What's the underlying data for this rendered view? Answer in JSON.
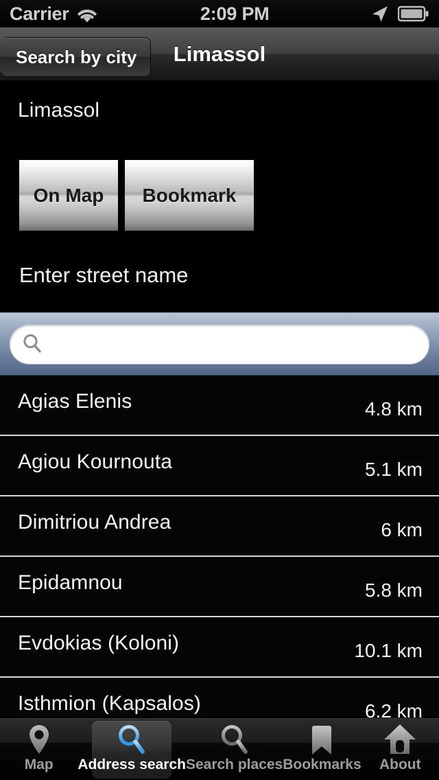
{
  "status_bar": {
    "carrier": "Carrier",
    "time": "2:09 PM",
    "wifi_icon": "wifi-icon",
    "location_icon": "location-arrow-icon",
    "battery_icon": "battery-icon"
  },
  "nav_bar": {
    "back_label": "Search by city",
    "title": "Limassol"
  },
  "main": {
    "city_name": "Limassol",
    "on_map_label": "On Map",
    "bookmark_label": "Bookmark",
    "street_prompt": "Enter street name"
  },
  "search": {
    "value": "",
    "placeholder": "",
    "icon": "search-icon"
  },
  "results": [
    {
      "name": "Agias Elenis",
      "distance": "4.8 km"
    },
    {
      "name": "Agiou Kournouta",
      "distance": "5.1 km"
    },
    {
      "name": "Dimitriou Andrea",
      "distance": "6 km"
    },
    {
      "name": "Epidamnou",
      "distance": "5.8 km"
    },
    {
      "name": "Evdokias (Koloni)",
      "distance": "10.1 km"
    },
    {
      "name": "Isthmion (Kapsalos)",
      "distance": "6.2 km"
    }
  ],
  "tabs": [
    {
      "label": "Map",
      "icon": "map-pin-icon",
      "selected": false
    },
    {
      "label": "Address search",
      "icon": "magnifier-blue-icon",
      "selected": true
    },
    {
      "label": "Search places",
      "icon": "magnifier-gray-icon",
      "selected": false
    },
    {
      "label": "Bookmarks",
      "icon": "bookmark-ribbon-icon",
      "selected": false
    },
    {
      "label": "About",
      "icon": "house-icon",
      "selected": false
    }
  ],
  "colors": {
    "accent_blue": "#4aa3e8",
    "searchbar_top": "#b9c5d7",
    "searchbar_bottom": "#54678a",
    "separator": "#d8d8d8",
    "background": "#000000"
  }
}
